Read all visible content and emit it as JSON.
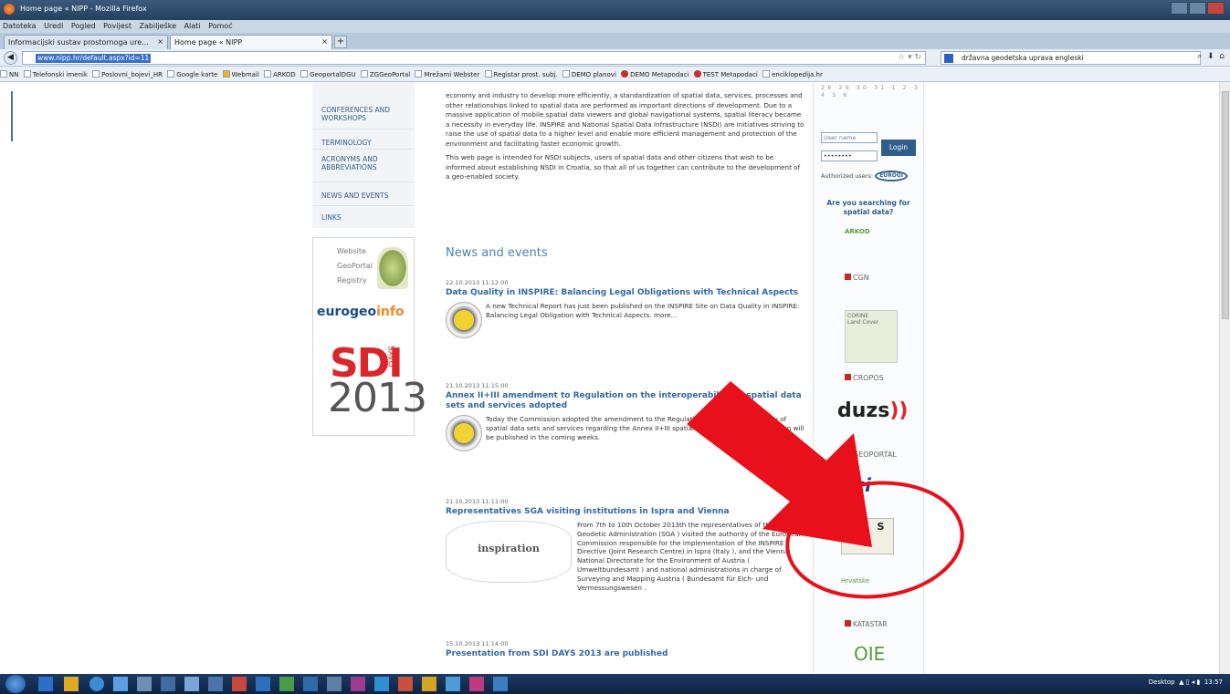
{
  "browser": {
    "title": "Home page « NIPP - Mozilla Firefox",
    "menu": [
      "Datoteka",
      "Uredi",
      "Pogled",
      "Povijest",
      "Zabilješke",
      "Alati",
      "Pomoć"
    ],
    "tabs": [
      {
        "label": "Informacijski sustav prostornoga ure..."
      },
      {
        "label": "Home page « NIPP"
      }
    ],
    "url": "www.nipp.hr/default.aspx?id=11",
    "search_value": "državna geodetska uprava engleski",
    "bookmarks": [
      "NN",
      "Telefonski imenik",
      "Poslovni_bojevi_HR",
      "Google karte",
      "Webmail",
      "ARKOD",
      "GeoportalDGU",
      "ZGGeoPortal",
      "Mrežami Webster",
      "Registar prost. subj.",
      "DEMO planovi",
      "DEMO Metapodaci",
      "TEST Metapodaci",
      "enciklopedija.hr"
    ]
  },
  "leftnav": {
    "items": [
      "CONFERENCES AND WORKSHOPS",
      "TERMINOLOGY",
      "ACRONYMS AND ABBREVIATIONS",
      "NEWS AND EVENTS",
      "LINKS"
    ]
  },
  "promo": {
    "website": "Website",
    "geoportal": "GeoPortal",
    "registry": "Registry",
    "eurogeo_a": "eurogeo",
    "eurogeo_b": "info",
    "sdi": "SDI",
    "days": "DAYS",
    "year": "2013"
  },
  "intro": {
    "p1": "economy and industry to develop more efficiently, a standardization of spatial data, services, processes and other relationships linked to spatial data are performed as important directions of development. Due to a massive application of mobile spatial data viewers and global navigational systems, spatial literacy became a necessity in everyday life. INSPIRE and National Spatial Data Infrastructure (NSDI) are initiatives striving to raise the use of spatial data to a higher level and enable more efficient management and protection of the environment and facilitating faster economic growth.",
    "p2": "This web page is intended for NSDI subjects, users of spatial data and other citizens that wish to be informed about establishing NSDI in Croatia, so that all of us together can contribute to the development of a geo-enabled society."
  },
  "news": {
    "heading": "News and events",
    "items": [
      {
        "date": "22.10.2013 11:12:00",
        "title": "Data Quality in INSPIRE: Balancing Legal Obligations with Technical Aspects",
        "body": "A new Technical Report has just been published on the INSPIRE Site on Data Quality in INSPIRE: Balancing Legal Obligation with Technical Aspects. more..."
      },
      {
        "date": "21.10.2013 11:15:00",
        "title": "Annex II+III amendment to Regulation on the interoperability of spatial data sets and services adopted",
        "body": "Today the Commission adopted the amendment to the Regulation on the interoperability of spatial data sets and services regarding the Annex II+III spatial data themes. The Regulation will be published in the coming weeks."
      },
      {
        "date": "21.10.2013 11:11:00",
        "title": "Representatives SGA visiting institutions in Ispra and Vienna",
        "body": "From 7th to 10th October 2013th the representatives of the State Geodetic Administration (SGA ) visited the authority of the European Commission responsible for the implementation of the INSPIRE Directive (Joint Research Centre) in Ispra (Italy ), and the Vienna National Directorate for the Environment of Austria ( Umweltbundesamt ) and national administrations in charge of Surveying and Mapping Austria ( Bundesamt für Eich- und Vermessungswesen ."
      },
      {
        "date": "15.10.2013 11:14:00",
        "title": "Presentation from SDI DAYS 2013 are published",
        "body": ""
      }
    ],
    "inspiration": "inspiration"
  },
  "right": {
    "calendar": "28 29 30 31 1 2 3 4 5 6",
    "username_placeholder": "User name",
    "password_value": "••••••••",
    "login_label": "Login",
    "authorized": "Authorized users:",
    "eurogi": "EUROGI",
    "searching": "Are you searching for spatial data?",
    "logos": {
      "arkod": "ARKOD",
      "cgn": "CGN",
      "corine_a": "CORINE",
      "corine_b": "Land Cover",
      "cropos": "CROPOS",
      "duzs_a": "duzs",
      "duzs_b": "))",
      "geoportal": "GEOPORTAL",
      "hci": "hci",
      "ipsu": "I P S U",
      "green": "Hrvatske",
      "katastar": "KATASTAR",
      "windmill": "OIE"
    }
  },
  "taskbar": {
    "desktop": "Desktop",
    "clock": "13:57"
  },
  "colors": {
    "annotation": "#e8101a",
    "link": "#3268a3",
    "nav": "#2f5d8c"
  }
}
